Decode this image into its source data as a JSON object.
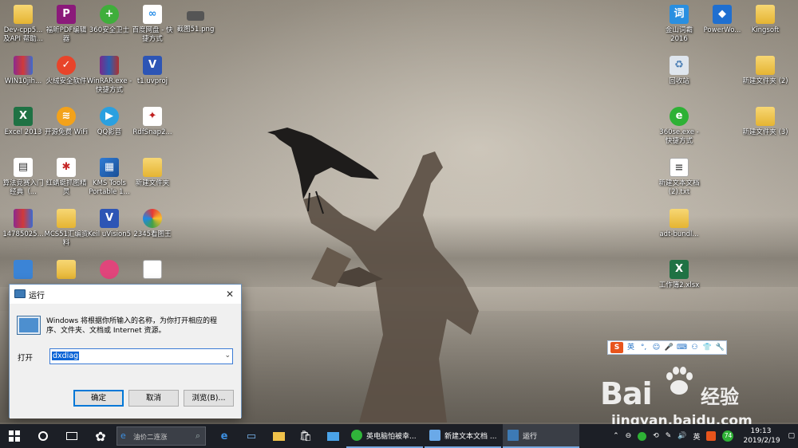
{
  "colors": {
    "taskbar": "#1c1f26",
    "accent": "#0078d7",
    "selection": "#0a64d6",
    "folder": "#e5b432"
  },
  "desktop": {
    "icons_left": [
      {
        "label": "Dev-cpp5... 及API 帮助...",
        "icon": "folder-icon"
      },
      {
        "label": "福昕PDF编辑器",
        "icon": "pdf-editor-icon"
      },
      {
        "label": "360安全卫士",
        "icon": "360-security-icon"
      },
      {
        "label": "百度网盘 - 快捷方式",
        "icon": "baidu-netdisk-icon"
      },
      {
        "label": "截图51.png",
        "icon": "image-file-icon"
      },
      {
        "label": "WIN10jih...",
        "icon": "archive-icon"
      },
      {
        "label": "火绒安全软件",
        "icon": "huorong-icon"
      },
      {
        "label": "WinRAR.exe - 快捷方式",
        "icon": "winrar-icon"
      },
      {
        "label": "t1.uvproj",
        "icon": "keil-project-icon"
      },
      {
        "label": "Excel 2013",
        "icon": "excel-icon"
      },
      {
        "label": "开源免费 WiFi",
        "icon": "wifi-icon"
      },
      {
        "label": "QQ影音",
        "icon": "qq-player-icon"
      },
      {
        "label": "RdfSnap2...",
        "icon": "rdfsnap-icon"
      },
      {
        "label": "算法竞赛入门经典（...",
        "icon": "book-icon"
      },
      {
        "label": "红蜻蜓抓图精灵",
        "icon": "dragonfly-icon"
      },
      {
        "label": "KMS Tools Portable 1...",
        "icon": "kms-tools-icon"
      },
      {
        "label": "新建文件夹",
        "icon": "folder-icon"
      },
      {
        "label": "14785025...",
        "icon": "archive-icon"
      },
      {
        "label": "MCS51汇编资料",
        "icon": "folder-icon"
      },
      {
        "label": "Keil uVision5",
        "icon": "keil-icon"
      },
      {
        "label": "2345看图王",
        "icon": "image-viewer-icon"
      }
    ],
    "icons_right": [
      {
        "label": "金山词霸 2016",
        "icon": "dictionary-icon"
      },
      {
        "label": "PowerWo...",
        "icon": "powerword-icon"
      },
      {
        "label": "Kingsoft",
        "icon": "folder-icon"
      },
      {
        "label": "回收站",
        "icon": "recycle-bin-icon"
      },
      {
        "label": "新建文件夹 (2)",
        "icon": "folder-icon"
      },
      {
        "label": "360se.exe - 快捷方式",
        "icon": "360-browser-icon"
      },
      {
        "label": "新建文件夹 (3)",
        "icon": "folder-icon"
      },
      {
        "label": "新建文本文档 (2).txt",
        "icon": "text-file-icon"
      },
      {
        "label": "adt-bundl...",
        "icon": "folder-icon"
      },
      {
        "label": "工作簿2.xlsx",
        "icon": "excel-file-icon"
      }
    ]
  },
  "run_dialog": {
    "title": "运行",
    "description": "Windows 将根据你所输入的名称，为你打开相应的程序、文件夹、文档或 Internet 资源。",
    "open_label": "打开",
    "input_value": "dxdiag",
    "ok_label": "确定",
    "cancel_label": "取消",
    "browse_label": "浏览(B)...",
    "close_glyph": "✕"
  },
  "ime": {
    "sogou": "S",
    "mode": "英"
  },
  "watermark": {
    "brand": "Bai",
    "cn": "经验",
    "url": "jingyan.baidu.com"
  },
  "taskbar": {
    "search_placeholder": "油价二连涨",
    "tasks": [
      {
        "label": "英电脑怕被幸...",
        "color": "#30b53a"
      },
      {
        "label": "新建文本文档 ...",
        "color": "#6aa9e8"
      },
      {
        "label": "运行",
        "color": "#3d7ab5"
      }
    ],
    "tray": {
      "ime": "英",
      "badge": "74",
      "time": "19:13",
      "date": "2019/2/19"
    }
  }
}
